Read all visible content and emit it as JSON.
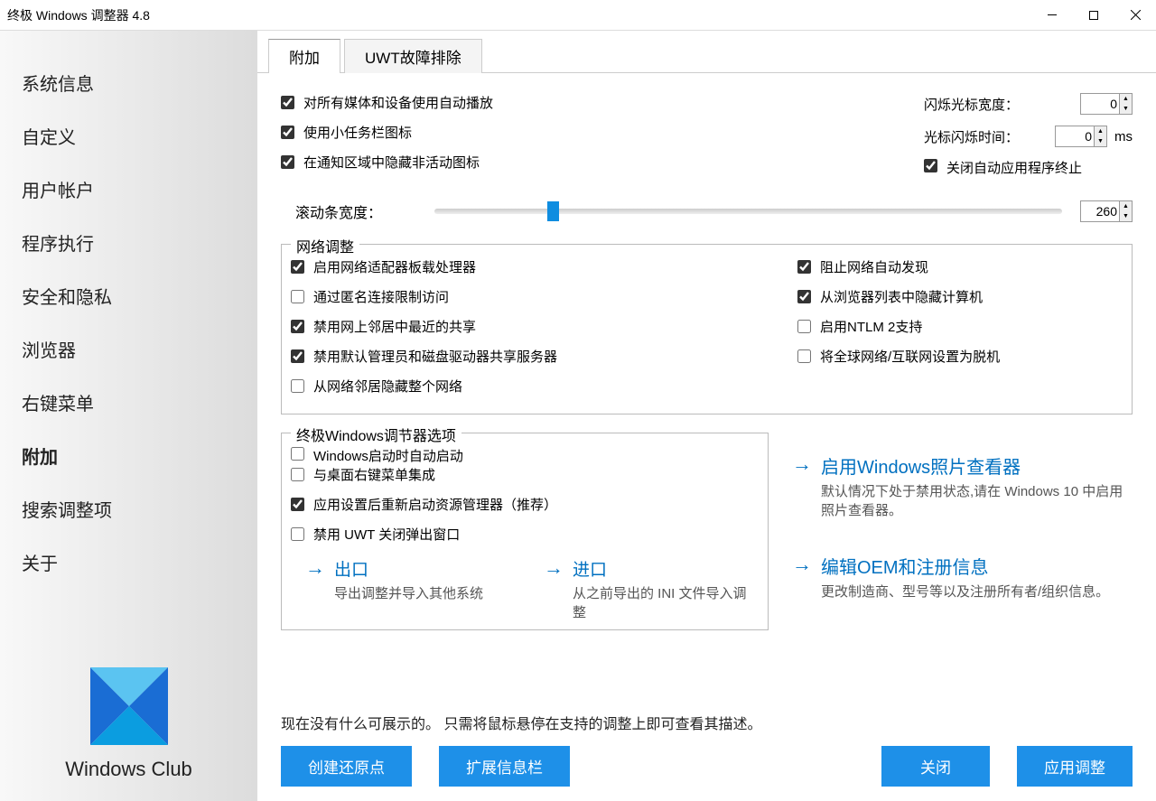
{
  "window": {
    "title": "终极 Windows 调整器 4.8"
  },
  "sidebar": {
    "items": [
      "系统信息",
      "自定义",
      "用户帐户",
      "程序执行",
      "安全和隐私",
      "浏览器",
      "右键菜单",
      "附加",
      "搜索调整项",
      "关于"
    ],
    "active": 7,
    "brand": "Windows Club"
  },
  "tabs": {
    "items": [
      "附加",
      "UWT故障排除"
    ],
    "active": 0
  },
  "topLeftChecks": [
    {
      "label": "对所有媒体和设备使用自动播放",
      "checked": true
    },
    {
      "label": "使用小任务栏图标",
      "checked": true
    },
    {
      "label": "在通知区域中隐藏非活动图标",
      "checked": true
    }
  ],
  "cursorWidth": {
    "label": "闪烁光标宽度：",
    "value": "0"
  },
  "cursorBlink": {
    "label": "光标闪烁时间：",
    "value": "0",
    "unit": "ms"
  },
  "autoTerminate": {
    "label": "关闭自动应用程序终止",
    "checked": true
  },
  "scroll": {
    "label": "滚动条宽度：",
    "value": "260"
  },
  "netGroup": {
    "legend": "网络调整",
    "left": [
      {
        "label": "启用网络适配器板载处理器",
        "checked": true
      },
      {
        "label": "通过匿名连接限制访问",
        "checked": false
      },
      {
        "label": "禁用网上邻居中最近的共享",
        "checked": true
      },
      {
        "label": "禁用默认管理员和磁盘驱动器共享服务器",
        "checked": true
      },
      {
        "label": "从网络邻居隐藏整个网络",
        "checked": false
      }
    ],
    "right": [
      {
        "label": "阻止网络自动发现",
        "checked": true
      },
      {
        "label": "从浏览器列表中隐藏计算机",
        "checked": true
      },
      {
        "label": "启用NTLM 2支持",
        "checked": false
      },
      {
        "label": "将全球网络/互联网设置为脱机",
        "checked": false
      }
    ]
  },
  "uwtGroup": {
    "legend": "终极Windows调节器选项",
    "items": [
      {
        "label": "Windows启动时自动启动",
        "checked": false
      },
      {
        "label": "与桌面右键菜单集成",
        "checked": false
      },
      {
        "label": "应用设置后重新启动资源管理器（推荐）",
        "checked": true
      },
      {
        "label": "禁用 UWT 关闭弹出窗口",
        "checked": false
      }
    ],
    "export": {
      "title": "出口",
      "desc": "导出调整并导入其他系统"
    },
    "import": {
      "title": "进口",
      "desc": "从之前导出的 INI 文件导入调整"
    }
  },
  "rightActions": {
    "photoViewer": {
      "title": "启用Windows照片查看器",
      "desc": "默认情况下处于禁用状态,请在 Windows 10 中启用照片查看器。"
    },
    "oem": {
      "title": "编辑OEM和注册信息",
      "desc": "更改制造商、型号等以及注册所有者/组织信息。"
    }
  },
  "footer": {
    "hint": "现在没有什么可展示的。 只需将鼠标悬停在支持的调整上即可查看其描述。",
    "buttons": {
      "restore": "创建还原点",
      "expand": "扩展信息栏",
      "close": "关闭",
      "apply": "应用调整"
    }
  }
}
